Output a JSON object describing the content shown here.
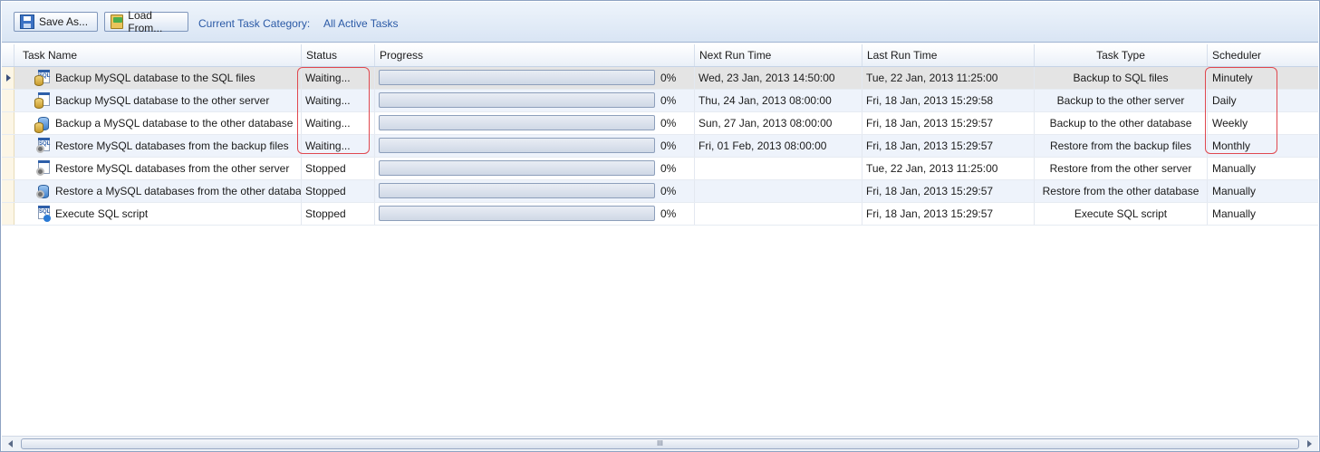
{
  "toolbar": {
    "save_label": "Save As...",
    "load_label": "Load From...",
    "category_label": "Current Task Category:",
    "category_value": "All Active Tasks"
  },
  "columns": [
    {
      "key": "name",
      "label": "Task Name"
    },
    {
      "key": "status",
      "label": "Status"
    },
    {
      "key": "progress",
      "label": "Progress"
    },
    {
      "key": "next_run",
      "label": "Next Run Time"
    },
    {
      "key": "last_run",
      "label": "Last Run Time"
    },
    {
      "key": "type",
      "label": "Task Type"
    },
    {
      "key": "scheduler",
      "label": "Scheduler"
    }
  ],
  "rows": [
    {
      "icon": "backup-sql-files-icon",
      "name": "Backup MySQL database to the SQL files",
      "status": "Waiting...",
      "progress": 0,
      "progress_text": "0%",
      "next_run": "Wed, 23 Jan, 2013 14:50:00",
      "last_run": "Tue, 22 Jan, 2013 11:25:00",
      "type": "Backup to SQL files",
      "scheduler": "Minutely"
    },
    {
      "icon": "backup-server-icon",
      "name": "Backup MySQL database to the other server",
      "status": "Waiting...",
      "progress": 0,
      "progress_text": "0%",
      "next_run": "Thu, 24 Jan, 2013 08:00:00",
      "last_run": "Fri, 18 Jan, 2013 15:29:58",
      "type": "Backup to the other server",
      "scheduler": "Daily"
    },
    {
      "icon": "backup-database-icon",
      "name": "Backup a MySQL database to the other database",
      "status": "Waiting...",
      "progress": 0,
      "progress_text": "0%",
      "next_run": "Sun, 27 Jan, 2013 08:00:00",
      "last_run": "Fri, 18 Jan, 2013 15:29:57",
      "type": "Backup to the other database",
      "scheduler": "Weekly"
    },
    {
      "icon": "restore-sql-files-icon",
      "name": "Restore MySQL databases from the backup files",
      "status": "Waiting...",
      "progress": 0,
      "progress_text": "0%",
      "next_run": "Fri, 01 Feb, 2013 08:00:00",
      "last_run": "Fri, 18 Jan, 2013 15:29:57",
      "type": "Restore from the backup files",
      "scheduler": "Monthly"
    },
    {
      "icon": "restore-server-icon",
      "name": "Restore MySQL databases from the other server",
      "status": "Stopped",
      "progress": 0,
      "progress_text": "0%",
      "next_run": "",
      "last_run": "Tue, 22 Jan, 2013 11:25:00",
      "type": "Restore from the other server",
      "scheduler": "Manually"
    },
    {
      "icon": "restore-database-icon",
      "name": "Restore a MySQL databases from the other databases",
      "status": "Stopped",
      "progress": 0,
      "progress_text": "0%",
      "next_run": "",
      "last_run": "Fri, 18 Jan, 2013 15:29:57",
      "type": "Restore from the other database",
      "scheduler": "Manually"
    },
    {
      "icon": "execute-sql-script-icon",
      "name": "Execute SQL script",
      "status": "Stopped",
      "progress": 0,
      "progress_text": "0%",
      "next_run": "",
      "last_run": "Fri, 18 Jan, 2013 15:29:57",
      "type": "Execute SQL script",
      "scheduler": "Manually"
    }
  ],
  "scrollbar": {
    "grip": "III"
  },
  "colors": {
    "highlight": "#e0484f",
    "accent": "#2b5aa6"
  }
}
